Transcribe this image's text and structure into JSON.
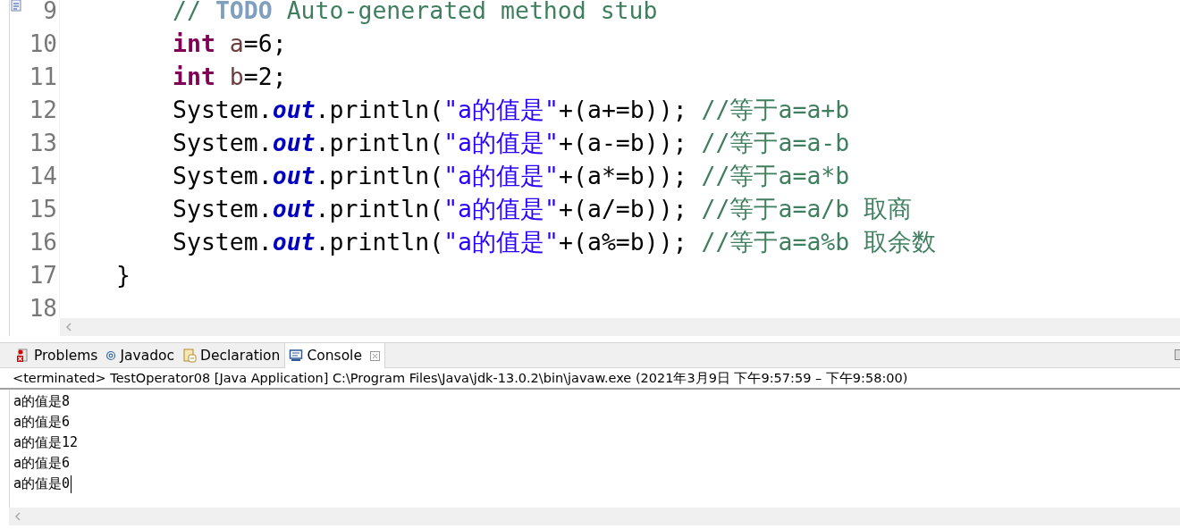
{
  "editor": {
    "lines": [
      {
        "number": "9",
        "kind": "statement",
        "marker": true,
        "tokens": [
          {
            "kind": "comment",
            "text": "// "
          },
          {
            "kind": "todo",
            "text": "TODO"
          },
          {
            "kind": "comment",
            "text": " Auto-generated method stub"
          }
        ]
      },
      {
        "number": "10",
        "kind": "statement",
        "marker": false,
        "tokens": [
          {
            "kind": "keyword",
            "text": "int "
          },
          {
            "kind": "variable",
            "text": "a"
          },
          {
            "kind": "plain",
            "text": "=6;"
          }
        ]
      },
      {
        "number": "11",
        "kind": "statement",
        "marker": false,
        "tokens": [
          {
            "kind": "keyword",
            "text": "int "
          },
          {
            "kind": "variable",
            "text": "b"
          },
          {
            "kind": "plain",
            "text": "=2;"
          }
        ]
      },
      {
        "number": "12",
        "kind": "statement",
        "marker": false,
        "tokens": [
          {
            "kind": "plain",
            "text": "System."
          },
          {
            "kind": "field",
            "text": "out"
          },
          {
            "kind": "plain",
            "text": ".println("
          },
          {
            "kind": "string",
            "text": "\"a的值是\""
          },
          {
            "kind": "plain",
            "text": "+(a+=b)); "
          },
          {
            "kind": "comment",
            "text": "//等于a=a+b"
          }
        ]
      },
      {
        "number": "13",
        "kind": "statement",
        "marker": false,
        "tokens": [
          {
            "kind": "plain",
            "text": "System."
          },
          {
            "kind": "field",
            "text": "out"
          },
          {
            "kind": "plain",
            "text": ".println("
          },
          {
            "kind": "string",
            "text": "\"a的值是\""
          },
          {
            "kind": "plain",
            "text": "+(a-=b)); "
          },
          {
            "kind": "comment",
            "text": "//等于a=a-b"
          }
        ]
      },
      {
        "number": "14",
        "kind": "statement",
        "marker": false,
        "tokens": [
          {
            "kind": "plain",
            "text": "System."
          },
          {
            "kind": "field",
            "text": "out"
          },
          {
            "kind": "plain",
            "text": ".println("
          },
          {
            "kind": "string",
            "text": "\"a的值是\""
          },
          {
            "kind": "plain",
            "text": "+(a*=b)); "
          },
          {
            "kind": "comment",
            "text": "//等于a=a*b"
          }
        ]
      },
      {
        "number": "15",
        "kind": "statement",
        "marker": false,
        "tokens": [
          {
            "kind": "plain",
            "text": "System."
          },
          {
            "kind": "field",
            "text": "out"
          },
          {
            "kind": "plain",
            "text": ".println("
          },
          {
            "kind": "string",
            "text": "\"a的值是\""
          },
          {
            "kind": "plain",
            "text": "+(a/=b)); "
          },
          {
            "kind": "comment",
            "text": "//等于a=a/b 取商"
          }
        ]
      },
      {
        "number": "16",
        "kind": "statement",
        "marker": false,
        "tokens": [
          {
            "kind": "plain",
            "text": "System."
          },
          {
            "kind": "field",
            "text": "out"
          },
          {
            "kind": "plain",
            "text": ".println("
          },
          {
            "kind": "string",
            "text": "\"a的值是\""
          },
          {
            "kind": "plain",
            "text": "+(a%=b)); "
          },
          {
            "kind": "comment",
            "text": "//等于a=a%b 取余数"
          }
        ]
      },
      {
        "number": "17",
        "kind": "block_end",
        "marker": false,
        "tokens": [
          {
            "kind": "plain",
            "text": "}"
          }
        ]
      },
      {
        "number": "18",
        "marker": false
      }
    ]
  },
  "tabs": [
    {
      "label": "Problems",
      "selected": false
    },
    {
      "label": "Javadoc",
      "selected": false
    },
    {
      "label": "Declaration",
      "selected": false
    },
    {
      "label": "Console",
      "selected": true
    }
  ],
  "console": {
    "header": "<terminated> TestOperator08 [Java Application] C:\\Program Files\\Java\\jdk-13.0.2\\bin\\javaw.exe  (2021年3月9日 下午9:57:59 – 下午9:58:00)",
    "output": [
      "a的值是8",
      "a的值是6",
      "a的值是12",
      "a的值是6",
      "a的值是0"
    ]
  }
}
